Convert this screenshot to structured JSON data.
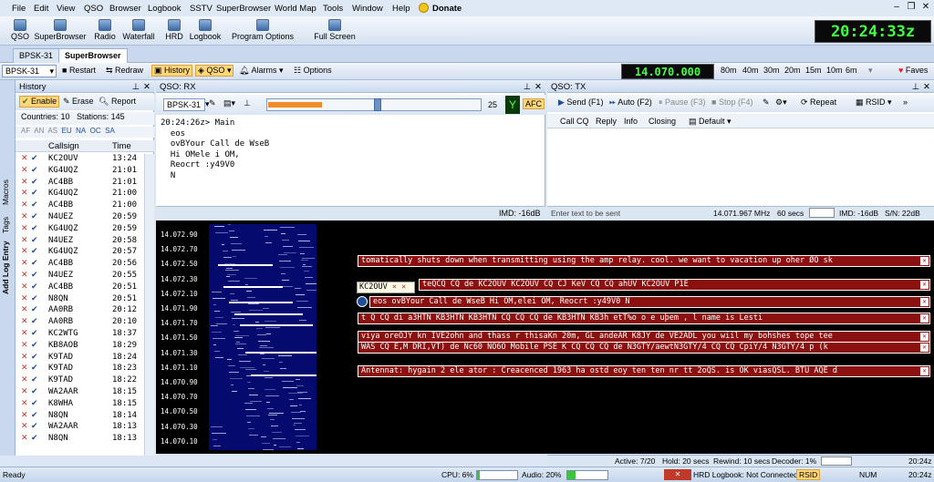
{
  "menu": [
    "File",
    "Edit",
    "View",
    "QSO",
    "Browser",
    "Logbook",
    "SSTV",
    "SuperBrowser",
    "World Map",
    "Tools",
    "Window",
    "Help"
  ],
  "donate": "Donate",
  "toolbar": {
    "buttons": [
      "QSO",
      "SuperBrowser",
      "Radio",
      "Waterfall",
      "HRD",
      "Logbook",
      "Program Options",
      "Full Screen"
    ]
  },
  "clock": "20:24:33z",
  "doc_tabs": [
    "BPSK-31",
    "SuperBrowser"
  ],
  "toolbar2": {
    "mode": "BPSK-31",
    "restart": "Restart",
    "redraw": "Redraw",
    "history": "History",
    "qso": "QSO",
    "alarms": "Alarms",
    "options": "Options",
    "frequency": "14.070.000",
    "bands": [
      "80m",
      "40m",
      "30m",
      "20m",
      "15m",
      "10m",
      "6m"
    ],
    "faves": "Faves"
  },
  "side_tabs": [
    "Macros",
    "Tags",
    "Add Log Entry"
  ],
  "history": {
    "title": "History",
    "enable": "Enable",
    "erase": "Erase",
    "report": "Report",
    "countries": "Countries: 10",
    "stations": "Stations: 145",
    "continents": [
      "AF",
      "AN",
      "AS",
      "EU",
      "NA",
      "OC",
      "SA"
    ],
    "col_callsign": "Callsign",
    "col_time": "Time",
    "rows": [
      {
        "call": "KC2OUV",
        "time": "13:24"
      },
      {
        "call": "KG4UQZ",
        "time": "21:01"
      },
      {
        "call": "AC4BB",
        "time": "21:01"
      },
      {
        "call": "KG4UQZ",
        "time": "21:00"
      },
      {
        "call": "AC4BB",
        "time": "21:00"
      },
      {
        "call": "N4UEZ",
        "time": "20:59"
      },
      {
        "call": "KG4UQZ",
        "time": "20:59"
      },
      {
        "call": "N4UEZ",
        "time": "20:58"
      },
      {
        "call": "KG4UQZ",
        "time": "20:57"
      },
      {
        "call": "AC4BB",
        "time": "20:56"
      },
      {
        "call": "N4UEZ",
        "time": "20:55"
      },
      {
        "call": "AC4BB",
        "time": "20:51"
      },
      {
        "call": "N8QN",
        "time": "20:51"
      },
      {
        "call": "AA0RB",
        "time": "20:12"
      },
      {
        "call": "AA0RB",
        "time": "20:10"
      },
      {
        "call": "KC2WTG",
        "time": "18:37"
      },
      {
        "call": "KB8AOB",
        "time": "18:29"
      },
      {
        "call": "K9TAD",
        "time": "18:24"
      },
      {
        "call": "K9TAD",
        "time": "18:23"
      },
      {
        "call": "K9TAD",
        "time": "18:22"
      },
      {
        "call": "WA2AAR",
        "time": "18:15"
      },
      {
        "call": "K8WHA",
        "time": "18:15"
      },
      {
        "call": "N8QN",
        "time": "18:14"
      },
      {
        "call": "WA2AAR",
        "time": "18:13"
      },
      {
        "call": "N8QN",
        "time": "18:13"
      }
    ]
  },
  "rx": {
    "title": "QSO: RX",
    "mode": "BPSK-31",
    "level": "25",
    "afc": "AFC",
    "text": "20:24:26z> Main\n  eos\n  ovBYour Call de WseB\n  Hi OMele i OM,\n  Reocrt :y49V0\n  N",
    "imd": "IMD: -16dB"
  },
  "tx": {
    "title": "QSO: TX",
    "send": "Send (F1)",
    "auto": "Auto (F2)",
    "pause": "Pause (F3)",
    "stop": "Stop (F4)",
    "repeat": "Repeat",
    "rsid": "RSID",
    "call_cq": "Call CQ",
    "reply": "Reply",
    "info": "Info",
    "closing": "Closing",
    "default": "Default",
    "placeholder": "Enter text to be sent",
    "freq": "14.071.967 MHz",
    "secs": "60 secs",
    "imd": "IMD: -16dB",
    "sn": "S/N: 22dB"
  },
  "waterfall": {
    "scale": [
      "14.072.90",
      "14.072.70",
      "14.072.50",
      "14.072.30",
      "14.072.10",
      "14.071.90",
      "14.071.70",
      "14.071.50",
      "14.071.30",
      "14.071.10",
      "14.070.90",
      "14.070.70",
      "14.070.50",
      "14.070.30",
      "14.070.10"
    ],
    "call_tag": "KC2OUV",
    "messages": [
      "tomatically shuts down when transmitting using the amp relay. cool. we want to vacation up oher ØO sk",
      "teQCQ CQ de KC2OUV KC2OUV CQ CJ KeV CQ CQ ahUV KC2OUV P1E",
      "eos ovBYour Call de WseB Hi OM,elei OM, Reocrt :y49V0 N",
      "t Q CQ di a3HTN KB3HTN KB3HTN CQ CQ CQ de KB3HTN KB3h etT%o o e uþem , l name is Lesti",
      "viya oreOJY kn IVE2ohn and thass r thisaKn 20m, GL andeAR K8JY de VE2ADL you wiil my bohshes tope tee",
      "WAS CQ E,M DRI,VT) de Nc60 NO6O Mobile PSE K CQ CQ CQ de N3GTY/aewtN3GTY/4 CQ CQ CpiY/4 N3GTY/4 p (k",
      "Antennat: hygain 2 ele ator : Creacenced 1963 ha ostd eoy ten ten nr tt 2oQS. is OK viasQSL. BTU AQE d"
    ],
    "active": "Active: 7/20",
    "hold": "Hold: 20 secs",
    "rewind": "Rewind: 10 secs",
    "decoder": "Decoder: 1%",
    "time": "20:24z"
  },
  "status": {
    "ready": "Ready",
    "cpu": "CPU: 6%",
    "cpu_level": 0.06,
    "audio": "Audio: 20%",
    "audio_level": 0.2,
    "hrd": "HRD Logbook: Not Connected",
    "rsid": "RSID",
    "num": "NUM",
    "time": "20:24z"
  },
  "colors": {
    "message_bg": "#8b1010",
    "clock_fg": "#42ff42",
    "waterfall_bg": "#050a6e"
  }
}
